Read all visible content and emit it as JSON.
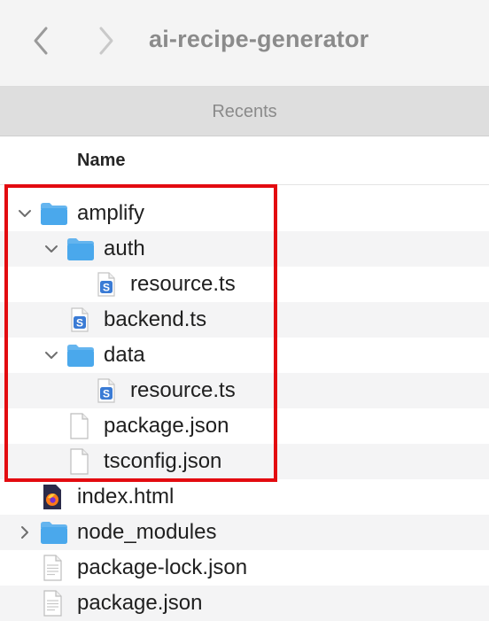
{
  "window": {
    "title": "ai-recipe-generator"
  },
  "tabs": {
    "recents": "Recents"
  },
  "columns": {
    "name": "Name"
  },
  "files": [
    {
      "name": "amplify",
      "kind": "folder",
      "depth": 0,
      "expanded": true
    },
    {
      "name": "auth",
      "kind": "folder",
      "depth": 1,
      "expanded": true
    },
    {
      "name": "resource.ts",
      "kind": "ts-file",
      "depth": 2
    },
    {
      "name": "backend.ts",
      "kind": "ts-file",
      "depth": 1
    },
    {
      "name": "data",
      "kind": "folder",
      "depth": 1,
      "expanded": true
    },
    {
      "name": "resource.ts",
      "kind": "ts-file",
      "depth": 2
    },
    {
      "name": "package.json",
      "kind": "document",
      "depth": 1
    },
    {
      "name": "tsconfig.json",
      "kind": "document",
      "depth": 1
    },
    {
      "name": "index.html",
      "kind": "html-file",
      "depth": 0
    },
    {
      "name": "node_modules",
      "kind": "folder",
      "depth": 0,
      "expanded": false
    },
    {
      "name": "package-lock.json",
      "kind": "document-text",
      "depth": 0
    },
    {
      "name": "package.json",
      "kind": "document-text",
      "depth": 0
    }
  ],
  "colors": {
    "folder": "#4aa8ec",
    "highlight_border": "#e30b10",
    "ts_badge": "#3a7bd5"
  }
}
